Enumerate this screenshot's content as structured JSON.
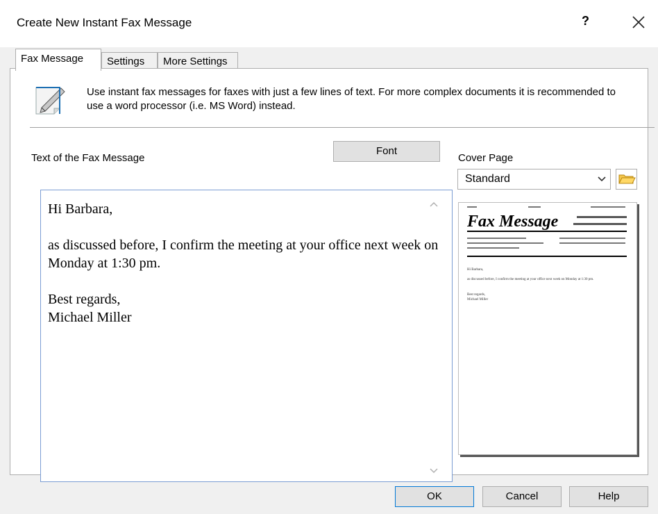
{
  "window": {
    "title": "Create New Instant Fax Message",
    "help_label": "?",
    "colors": {
      "title_bg": "#ffffff",
      "panel_bg": "#ffffff",
      "frame_bg": "#f0f0f0",
      "button_border": "#adadad",
      "accent": "#0078d7"
    }
  },
  "tabs": [
    {
      "label": "Fax Message",
      "active": true
    },
    {
      "label": "Settings"
    },
    {
      "label": "More Settings"
    }
  ],
  "intro": {
    "icon": "pen-document-icon",
    "text": "Use instant fax messages for faxes with just a few lines of text. For more complex documents it is recommended to use a word processor (i.e. MS Word) instead."
  },
  "message": {
    "label": "Text of the Fax Message",
    "font_button": "Font",
    "body": "Hi Barbara,\n\nas discussed before, I confirm the meeting at your office next week on Monday at 1:30 pm.\n\nBest regards,\nMichael Miller"
  },
  "cover_page": {
    "label": "Cover Page",
    "selected": "Standard",
    "preview": {
      "title": "Fax Message",
      "greeting": "Hi Barbara,",
      "text": "as discussed before, I confirm the meeting at your office next week on Monday at 1:30 pm.",
      "closing": "Best regards,",
      "signature": "Michael Miller"
    }
  },
  "footer": {
    "ok": "OK",
    "cancel": "Cancel",
    "help": "Help"
  }
}
